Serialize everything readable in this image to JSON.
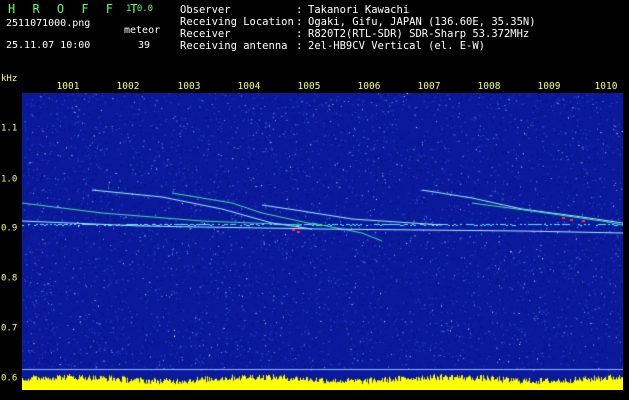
{
  "header": {
    "brand": "H R O F F T",
    "version": "1.0.0",
    "filename": "2511071000.png",
    "meteor_label": "meteor",
    "datetime": "25.11.07 10:00",
    "meteor_count": "39"
  },
  "info": [
    {
      "label": "Observer",
      "value": "Takanori Kawachi"
    },
    {
      "label": "Receiving Location",
      "value": "Ogaki, Gifu, JAPAN (136.60E, 35.35N)"
    },
    {
      "label": "Receiver",
      "value": "R820T2(RTL-SDR) SDR-Sharp 53.372MHz"
    },
    {
      "label": "Receiving antenna",
      "value": "2el-HB9CV Vertical (el. E-W)"
    }
  ],
  "info_separator": ":",
  "axis": {
    "y_unit": "kHz",
    "y_ticks": [
      "1.1",
      "1.0",
      "0.9",
      "0.8",
      "0.7",
      "0.6"
    ],
    "x_ticks": [
      "1001",
      "1002",
      "1003",
      "1004",
      "1005",
      "1006",
      "1007",
      "1008",
      "1009",
      "1010"
    ]
  },
  "colors": {
    "header_green": "#5cff6a",
    "header_white": "#ffffff",
    "tick_yellow": "#ffff66",
    "noise_base": "#0b1a9c",
    "level_bar": "#ffff00"
  }
}
